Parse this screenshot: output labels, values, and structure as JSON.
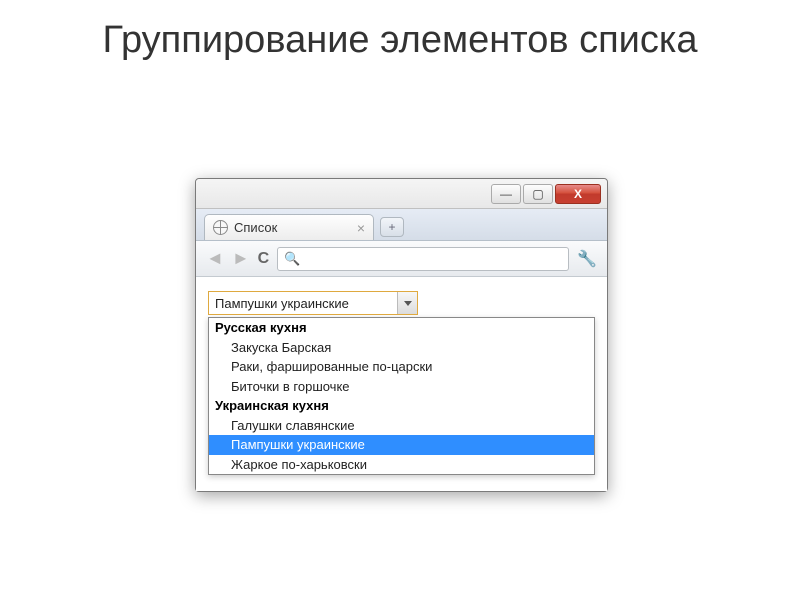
{
  "slide": {
    "title": "Группирование элементов списка"
  },
  "browser": {
    "tab_title": "Список",
    "select_value": "Пампушки украинские",
    "groups": [
      {
        "label": "Русская кухня",
        "options": [
          {
            "text": "Закуска Барская",
            "selected": false
          },
          {
            "text": "Раки, фаршированные по-царски",
            "selected": false
          },
          {
            "text": "Биточки в горшочке",
            "selected": false
          }
        ]
      },
      {
        "label": "Украинская кухня",
        "options": [
          {
            "text": "Галушки славянские",
            "selected": false
          },
          {
            "text": "Пампушки украинские",
            "selected": true
          },
          {
            "text": "Жаркое по-харьковски",
            "selected": false
          }
        ]
      }
    ]
  }
}
